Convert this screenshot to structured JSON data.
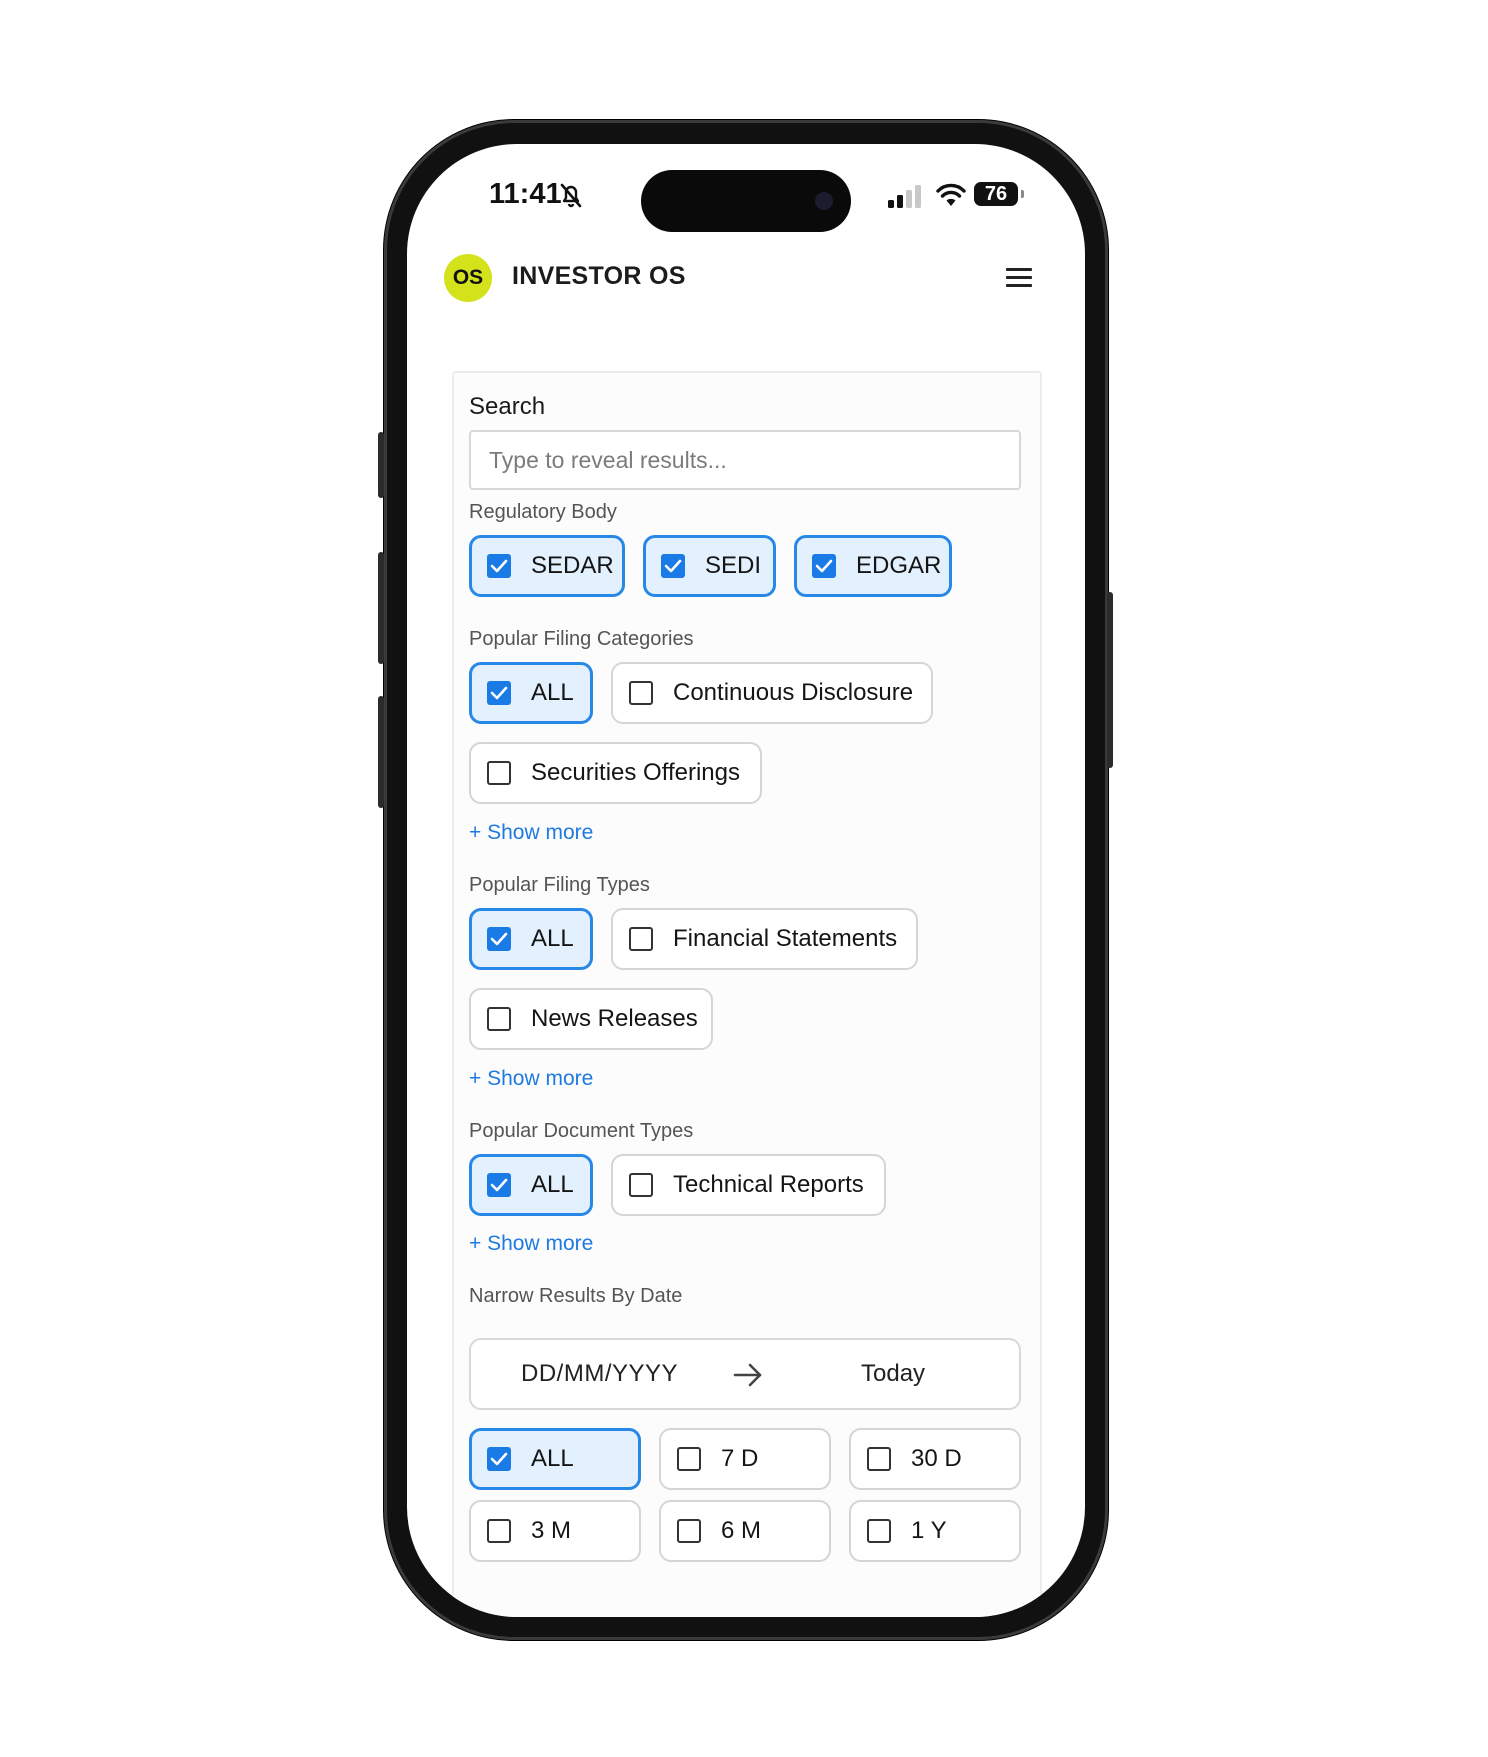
{
  "status_bar": {
    "time": "11:41",
    "battery": "76"
  },
  "header": {
    "logo_text": "OS",
    "title": "INVESTOR OS"
  },
  "search": {
    "label": "Search",
    "placeholder": "Type to reveal results..."
  },
  "regulatory_body": {
    "label": "Regulatory Body",
    "options": [
      {
        "label": "SEDAR",
        "checked": true
      },
      {
        "label": "SEDI",
        "checked": true
      },
      {
        "label": "EDGAR",
        "checked": true
      }
    ]
  },
  "filing_categories": {
    "label": "Popular Filing Categories",
    "options": [
      {
        "label": "ALL",
        "checked": true
      },
      {
        "label": "Continuous Disclosure",
        "checked": false
      },
      {
        "label": "Securities Offerings",
        "checked": false
      }
    ],
    "show_more": "+ Show more"
  },
  "filing_types": {
    "label": "Popular Filing Types",
    "options": [
      {
        "label": "ALL",
        "checked": true
      },
      {
        "label": "Financial Statements",
        "checked": false
      },
      {
        "label": "News Releases",
        "checked": false
      }
    ],
    "show_more": "+ Show more"
  },
  "document_types": {
    "label": "Popular Document Types",
    "options": [
      {
        "label": "ALL",
        "checked": true
      },
      {
        "label": "Technical Reports",
        "checked": false
      }
    ],
    "show_more": "+ Show more"
  },
  "date": {
    "label": "Narrow Results By Date",
    "from_placeholder": "DD/MM/YYYY",
    "to_value": "Today",
    "ranges": [
      {
        "label": "ALL",
        "checked": true
      },
      {
        "label": "7 D",
        "checked": false
      },
      {
        "label": "30 D",
        "checked": false
      },
      {
        "label": "3 M",
        "checked": false
      },
      {
        "label": "6 M",
        "checked": false
      },
      {
        "label": "1 Y",
        "checked": false
      }
    ]
  },
  "colors": {
    "accent": "#1a7ae6",
    "logo_bg": "#d4e21b",
    "chip_selected_bg": "#e3f0fd"
  }
}
